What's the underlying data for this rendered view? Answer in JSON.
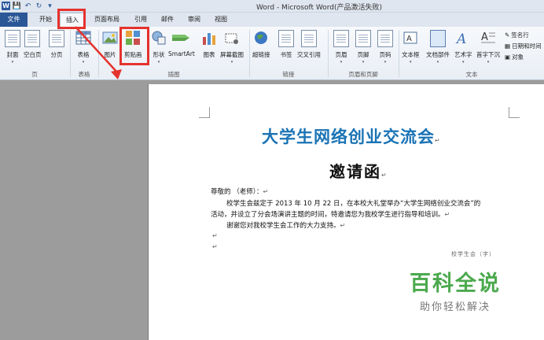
{
  "window": {
    "title": "Word  -  Microsoft Word(产品激活失败)"
  },
  "quick_access": {
    "app_badge": "W",
    "icons": [
      "save-icon",
      "undo-icon",
      "redo-icon",
      "customize-icon"
    ]
  },
  "tabs": [
    {
      "label": "文件",
      "id": "file"
    },
    {
      "label": "开始",
      "id": "home"
    },
    {
      "label": "插入",
      "id": "insert",
      "active": true
    },
    {
      "label": "页面布局",
      "id": "page-layout"
    },
    {
      "label": "引用",
      "id": "references"
    },
    {
      "label": "邮件",
      "id": "mailings"
    },
    {
      "label": "审阅",
      "id": "review"
    },
    {
      "label": "视图",
      "id": "view"
    }
  ],
  "ribbon": {
    "buttons": {
      "cover": "封面",
      "blank_page": "空白页",
      "page_break": "分页",
      "table": "表格",
      "picture": "图片",
      "clip_art": "剪贴画",
      "shapes": "形状",
      "smartart": "SmartArt",
      "chart": "图表",
      "screenshot": "屏幕截图",
      "hyperlink": "超链接",
      "bookmark": "书签",
      "cross_ref": "交叉引用",
      "header": "页眉",
      "footer": "页脚",
      "page_number": "页码",
      "textbox": "文本框",
      "quick_parts": "文档部件",
      "wordart": "艺术字",
      "drop_cap": "首字下沉",
      "signature_line": "签名行",
      "date_time": "日期和时间",
      "object": "对象"
    },
    "groups": {
      "pages": "页",
      "tables": "表格",
      "illustrations": "插图",
      "links": "链接",
      "header_footer": "页眉和页脚",
      "text": "文本"
    }
  },
  "document": {
    "title": "大学生网络创业交流会",
    "subtitle": "邀请函",
    "para_mark": "↵",
    "salutation": "尊敬的            （老师）：",
    "body_line1": "校学生会兹定于 2013 年 10 月 22 日，在本校大礼堂举办“大学生网络创业交流会”的",
    "body_line2": "活动，并设立了分会场演讲主题的时间，特邀请您为我校学生进行指导和培训。",
    "body_line3": "谢谢您对我校学生会工作的大力支持。",
    "cutoff_text": "校学生会（字）"
  },
  "annotation": {
    "color": "#e5322d"
  },
  "watermark": {
    "main": "百科全说",
    "sub": "助你轻松解决"
  },
  "colors": {
    "accent_blue": "#2b579a",
    "title_blue": "#1a73b5",
    "watermark_green": "#4ba94e"
  }
}
